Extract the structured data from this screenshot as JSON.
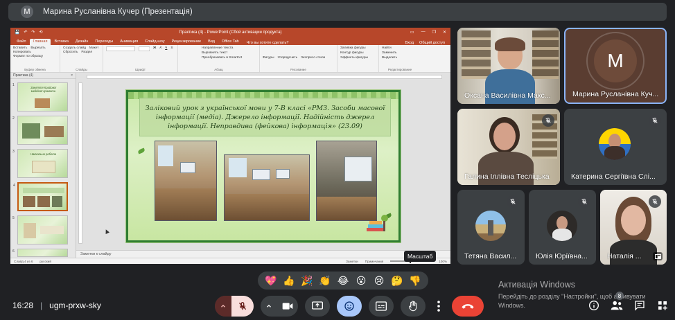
{
  "presenter_banner": {
    "avatar_letter": "M",
    "title": "Марина Русланівна Кучер (Презентація)"
  },
  "powerpoint": {
    "window_title": "Практика (4) - PowerPoint (Сбой активации продукта)",
    "quick_access": [
      "💾",
      "↶",
      "↷",
      "⟲"
    ],
    "window_buttons": [
      "▭",
      "—",
      "❐",
      "✕"
    ],
    "menu_tabs": [
      "Файл",
      "Главная",
      "Вставка",
      "Дизайн",
      "Переходы",
      "Анимация",
      "Слайд-шоу",
      "Рецензирование",
      "Вид",
      "Office Tab"
    ],
    "tell_me": "Что вы хотите сделать?",
    "menu_right": [
      "Вход",
      "Общий доступ"
    ],
    "ribbon_groups": [
      {
        "name": "Буфер обмена",
        "items": [
          "Вставить",
          "Вырезать",
          "Копировать",
          "Формат по образцу"
        ]
      },
      {
        "name": "Слайды",
        "items": [
          "Создать слайд",
          "Макет",
          "Сбросить",
          "Раздел"
        ]
      },
      {
        "name": "Шрифт",
        "items": [
          "Шрифт",
          "Размер",
          "Ж",
          "К",
          "Ч",
          "S"
        ]
      },
      {
        "name": "Абзац",
        "items": [
          "Направление текста",
          "Выровнять текст",
          "Преобразовать в SmartArt"
        ]
      },
      {
        "name": "Рисование",
        "items": [
          "Фигуры",
          "Упорядочить",
          "Экспресс-стили"
        ]
      },
      {
        "name": "",
        "items": [
          "Заливка фигуры",
          "Контур фигуры",
          "Эффекты фигуры"
        ]
      },
      {
        "name": "Редактирование",
        "items": [
          "Найти",
          "Заменить",
          "Выделить"
        ]
      }
    ],
    "thumbs_tab": "Практика (4)",
    "thumbnails": [
      {
        "num": "1",
        "title": "Заняття Крайової медійної грамоти"
      },
      {
        "num": "2",
        "title": ""
      },
      {
        "num": "3",
        "title": "Навчальна робота"
      },
      {
        "num": "4",
        "title": ""
      },
      {
        "num": "5",
        "title": ""
      },
      {
        "num": "6",
        "title": ""
      }
    ],
    "slide_title": "Заліковий урок з української мови у 7-В класі «РМЗ. Засоби масової інформації (медіа). Джерело інформації. Надійність джерел інформації. Неправдива (фейкова) інформація» (23.09)",
    "notes_placeholder": "Заметки к слайду",
    "status_left": [
      "Слайд 4 из 6",
      "русский"
    ],
    "status_right": [
      "Заметки",
      "Примечания",
      "100%"
    ],
    "tooltip": "Масштаб"
  },
  "participants": [
    {
      "name": "Оксана Василівна Макс...",
      "muted": false,
      "kind": "camera"
    },
    {
      "name": "Марина Русланівна Куч...",
      "muted": false,
      "kind": "avatar",
      "letter": "M"
    },
    {
      "name": "Галина Іллівна Тесліцька",
      "muted": true,
      "kind": "camera"
    },
    {
      "name": "Катерина Сергіївна Слі...",
      "muted": true,
      "kind": "avatar-photo"
    },
    {
      "name": "Тетяна Васил...",
      "muted": true,
      "kind": "avatar-photo"
    },
    {
      "name": "Юлія Юріївна...",
      "muted": true,
      "kind": "avatar-photo"
    },
    {
      "name": "Наталія ...",
      "muted": true,
      "kind": "camera"
    }
  ],
  "reactions": [
    "💖",
    "👍",
    "🎉",
    "👏",
    "😂",
    "😮",
    "😢",
    "🤔",
    "👎"
  ],
  "meeting": {
    "time": "16:28",
    "separator": "|",
    "code": "ugm-prxw-sky"
  },
  "people_count": "8",
  "activation": {
    "title": "Активація Windows",
    "subtitle": "Перейдіть до розділу \"Настройки\", щоб активувати Windows."
  },
  "colors": {
    "meet_bg": "#202124",
    "tile_bg": "#3c4043",
    "ppt_accent": "#b7472a",
    "end_call": "#ea4335",
    "active_blue": "#a8c7fa",
    "mic_off_bg": "#f9dedc"
  }
}
